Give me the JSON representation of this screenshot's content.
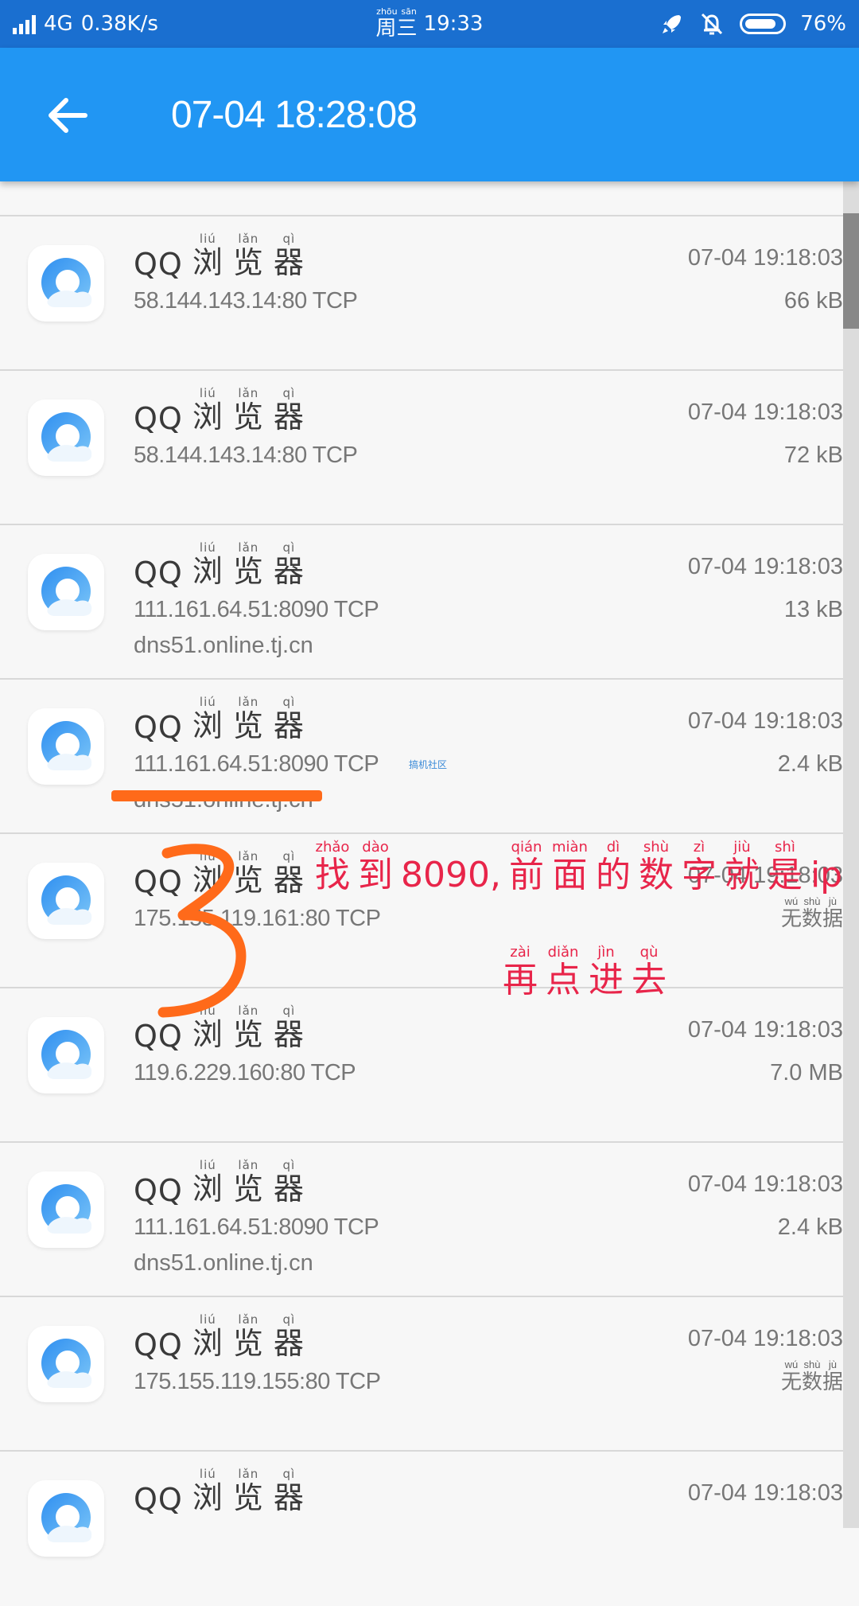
{
  "status_bar": {
    "network": "4G",
    "speed": "0.38K/s",
    "day_text": "周三",
    "day_pinyin": "zhōu sān",
    "time": "19:33",
    "battery": "76%"
  },
  "app_bar": {
    "title": "07-04  18:28:08"
  },
  "rows": [
    {
      "app": "QQ",
      "addr": "58.144.143.14:80   TCP",
      "host": "",
      "time": "07-04  19:18:03",
      "size": "66  kB"
    },
    {
      "app": "QQ",
      "addr": "58.144.143.14:80   TCP",
      "host": "",
      "time": "07-04  19:18:03",
      "size": "72  kB"
    },
    {
      "app": "QQ",
      "addr": "111.161.64.51:8090   TCP",
      "host": "dns51.online.tj.cn",
      "time": "07-04  19:18:03",
      "size": "13  kB"
    },
    {
      "app": "QQ",
      "addr": "111.161.64.51:8090   TCP",
      "host": "dns51.online.tj.cn",
      "time": "07-04  19:18:03",
      "size": "2.4  kB"
    },
    {
      "app": "QQ",
      "addr": "175.155.119.161:80   TCP",
      "host": "",
      "time": "07-04  19:18:03",
      "size": "无数据"
    },
    {
      "app": "QQ",
      "addr": "119.6.229.160:80   TCP",
      "host": "",
      "time": "07-04  19:18:03",
      "size": "7.0  MB"
    },
    {
      "app": "QQ",
      "addr": "111.161.64.51:8090   TCP",
      "host": "dns51.online.tj.cn",
      "time": "07-04  19:18:03",
      "size": "2.4  kB"
    },
    {
      "app": "QQ",
      "addr": "175.155.119.155:80   TCP",
      "host": "",
      "time": "07-04  19:18:03",
      "size": "无数据"
    },
    {
      "app": "QQ",
      "addr": "",
      "host": "",
      "time": "07-04  19:18:03",
      "size": ""
    }
  ],
  "app_name_cn": [
    "浏",
    "览",
    "器"
  ],
  "app_name_pinyin": [
    "liú",
    "lǎn",
    "qì"
  ],
  "no_data": {
    "chars": [
      "无",
      "数",
      "据"
    ],
    "pinyin": [
      "wú",
      "shù",
      "jù"
    ]
  },
  "annotation": {
    "watermark": "搞机社区",
    "digit": "3",
    "line1": [
      {
        "c": "找",
        "p": "zhǎo"
      },
      {
        "c": "到",
        "p": "dào"
      },
      {
        "c": "8090,",
        "p": ""
      },
      {
        "c": "前",
        "p": "qián"
      },
      {
        "c": "面",
        "p": "miàn"
      },
      {
        "c": "的",
        "p": "dì"
      },
      {
        "c": "数",
        "p": "shù"
      },
      {
        "c": "字",
        "p": "zì"
      },
      {
        "c": "就",
        "p": "jiù"
      },
      {
        "c": "是",
        "p": "shì"
      },
      {
        "c": "ip",
        "p": ""
      }
    ],
    "line2": [
      {
        "c": "再",
        "p": "zài"
      },
      {
        "c": "点",
        "p": "diǎn"
      },
      {
        "c": "进",
        "p": "jìn"
      },
      {
        "c": "去",
        "p": "qù"
      }
    ]
  },
  "colors": {
    "status_bar": "#1a6fd0",
    "app_bar": "#2196f3",
    "annotation_text": "#e8254a",
    "annotation_marks": "#ff6a1a"
  }
}
